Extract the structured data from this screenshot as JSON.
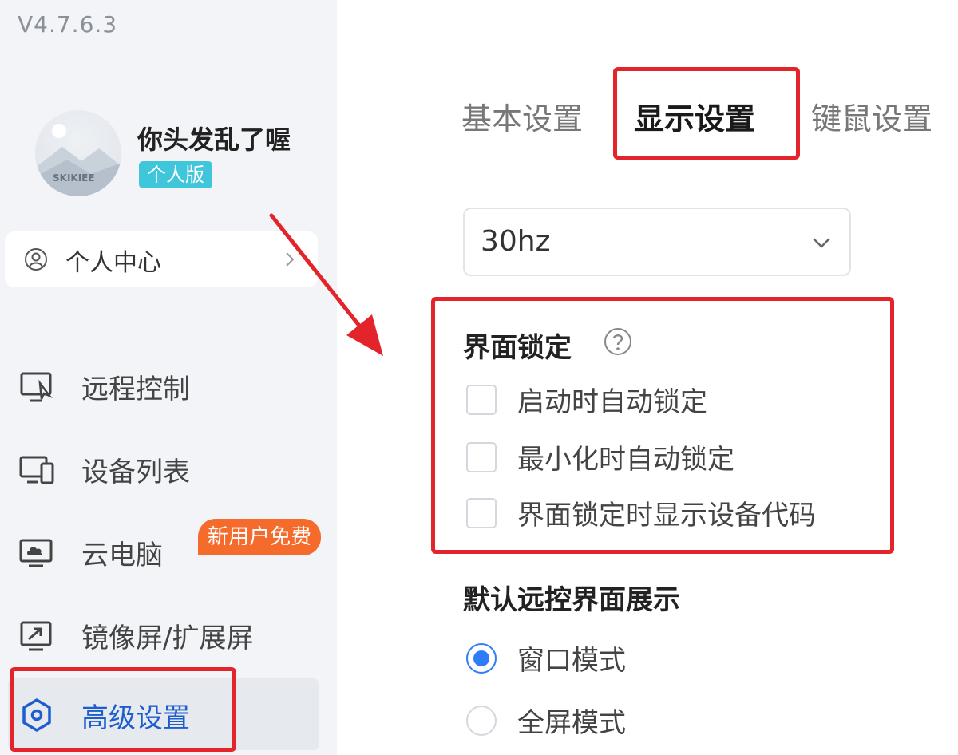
{
  "app": {
    "version": "V4.7.6.3"
  },
  "user": {
    "name": "你头发乱了喔",
    "edition": "个人版",
    "avatar_text": "SKIKIEE"
  },
  "sidebar": {
    "personal_center": "个人中心",
    "items": [
      {
        "label": "远程控制",
        "icon": "remote-control-icon"
      },
      {
        "label": "设备列表",
        "icon": "device-list-icon"
      },
      {
        "label": "云电脑",
        "icon": "cloud-pc-icon",
        "badge": "新用户免费"
      },
      {
        "label": "镜像屏/扩展屏",
        "icon": "mirror-screen-icon"
      },
      {
        "label": "高级设置",
        "icon": "advanced-settings-icon",
        "active": true
      }
    ]
  },
  "tabs": [
    {
      "label": "基本设置",
      "active": false
    },
    {
      "label": "显示设置",
      "active": true
    },
    {
      "label": "键鼠设置",
      "active": false
    }
  ],
  "display": {
    "refresh_rate": "30hz"
  },
  "interface_lock": {
    "title": "界面锁定",
    "options": [
      {
        "label": "启动时自动锁定",
        "checked": false
      },
      {
        "label": "最小化时自动锁定",
        "checked": false
      },
      {
        "label": "界面锁定时显示设备代码",
        "checked": false
      }
    ]
  },
  "default_view": {
    "title": "默认远控界面展示",
    "options": [
      {
        "label": "窗口模式",
        "selected": true
      },
      {
        "label": "全屏模式",
        "selected": false
      }
    ]
  },
  "colors": {
    "accent": "#2f7df6",
    "active_nav": "#1c5ecf",
    "badge_teal": "#3fc6da",
    "badge_orange": "#f46b2c",
    "annotation_red": "#e3242b"
  }
}
